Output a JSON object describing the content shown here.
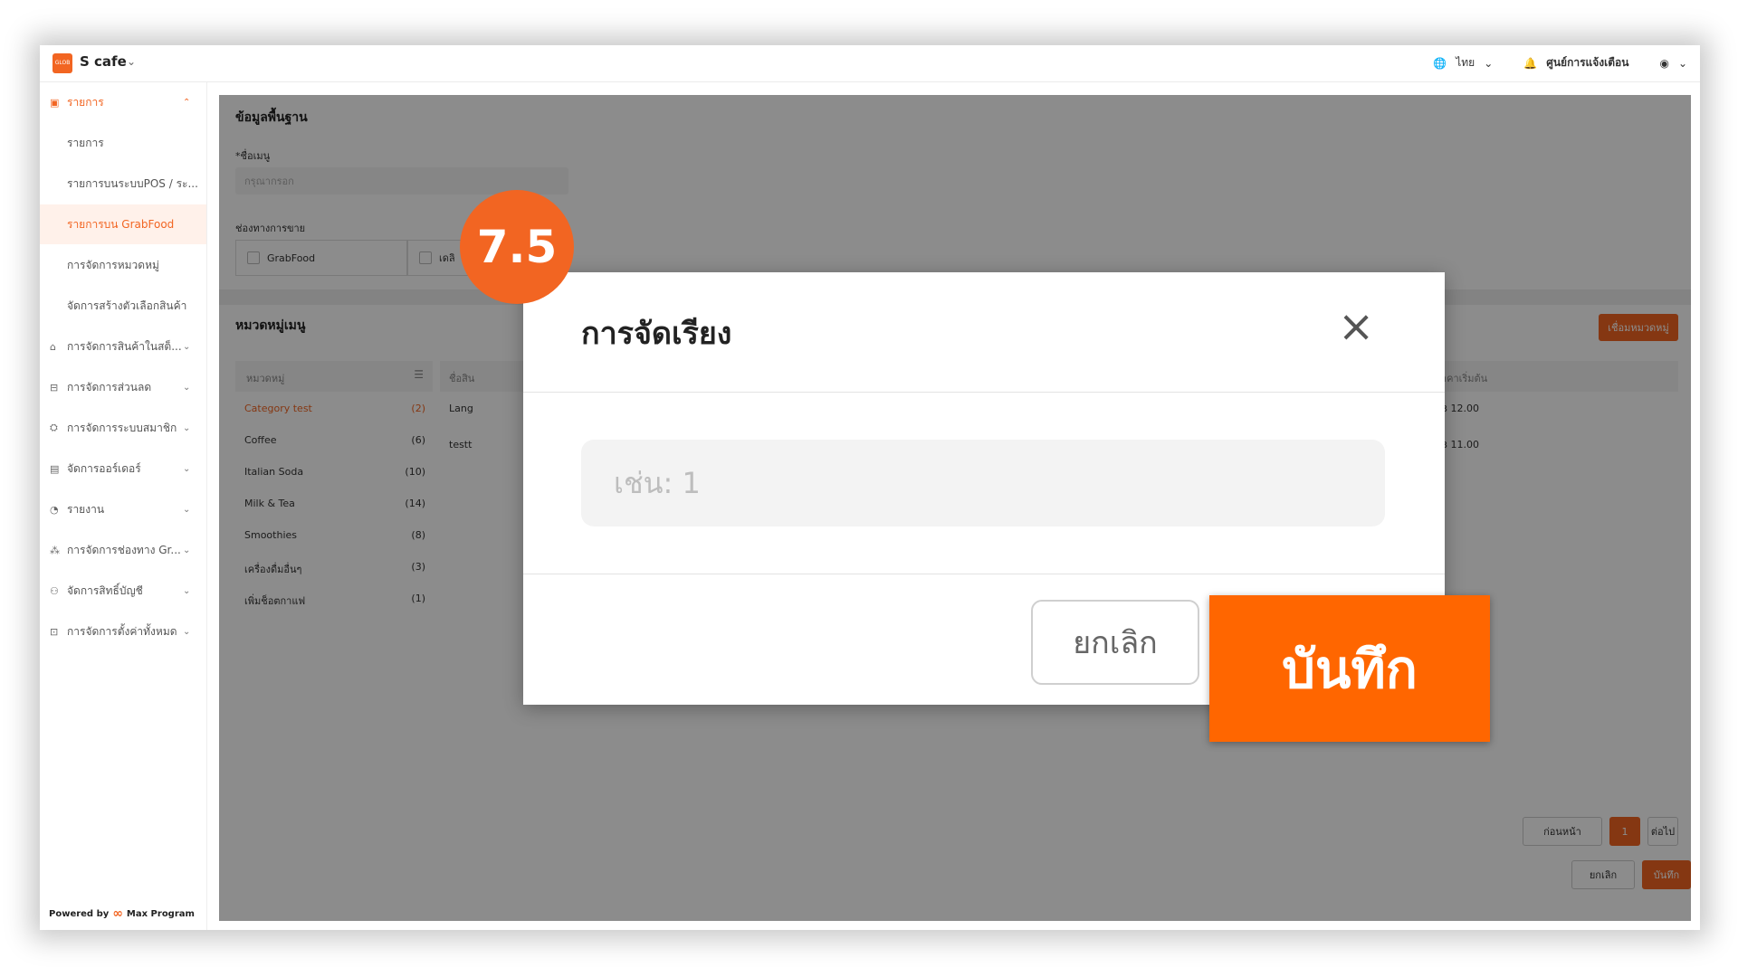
{
  "topbar": {
    "logo_text": "GLOB",
    "store_name": "S cafe",
    "language": "ไทย",
    "notification_center": "ศูนย์การแจ้งเตือน"
  },
  "sidebar": {
    "section_items": {
      "label": "รายการ",
      "children": [
        "รายการ",
        "รายการบนระบบPOS / ระ...",
        "รายการบน GrabFood",
        "การจัดการหมวดหมู่",
        "จัดการสร้างตัวเลือกสินค้า"
      ],
      "active_child": "รายการบน GrabFood"
    },
    "groups": [
      "การจัดการสินค้าในสต็...",
      "การจัดการส่วนลด",
      "การจัดการระบบสมาชิก",
      "จัดการออร์เดอร์",
      "รายงาน",
      "การจัดการช่องทาง Gr...",
      "จัดการสิทธิ์บัญชี",
      "การจัดการตั้งค่าทั้งหมด"
    ],
    "powered_by": "Powered by",
    "powered_logo": "Max Program"
  },
  "main": {
    "basic_info_title": "ข้อมูลพื้นฐาน",
    "menu_name_label": "*ชื่อเมนู",
    "menu_name_placeholder": "กรุณากรอก",
    "sales_channel_label": "ช่องทางการขาย",
    "channels": [
      "GrabFood",
      "เดลิ"
    ],
    "menu_category_title": "หมวดหมู่เมนู",
    "link_category_button": "เชื่อมหมวดหมู่",
    "category_header": "หมวดหมู่",
    "product_name_header": "ชื่อสิน",
    "start_price_header": "ราคาเริ่มต้น",
    "categories": [
      {
        "name": "Category test",
        "count": "(2)"
      },
      {
        "name": "Coffee",
        "count": "(6)"
      },
      {
        "name": "Italian Soda",
        "count": "(10)"
      },
      {
        "name": "Milk & Tea",
        "count": "(14)"
      },
      {
        "name": "Smoothies",
        "count": "(8)"
      },
      {
        "name": "เครื่องดื่มอื่นๆ",
        "count": "(3)"
      },
      {
        "name": "เพิ่มช็อตกาแฟ",
        "count": "(1)"
      }
    ],
    "products": [
      {
        "name": "Lang",
        "price": "฿ 12.00"
      },
      {
        "name": "testt",
        "price": "฿ 11.00"
      }
    ],
    "pagination": {
      "prev": "ก่อนหน้า",
      "page": "1",
      "next": "ต่อไป"
    },
    "cancel_button": "ยกเลิก",
    "save_button": "บันทึก"
  },
  "modal": {
    "title": "การจัดเรียง",
    "close_icon": "×",
    "input_placeholder": "เช่น: 1",
    "cancel_button": "ยกเลิก"
  },
  "callout": {
    "step_badge": "7.5",
    "save_label": "บันทึก"
  }
}
